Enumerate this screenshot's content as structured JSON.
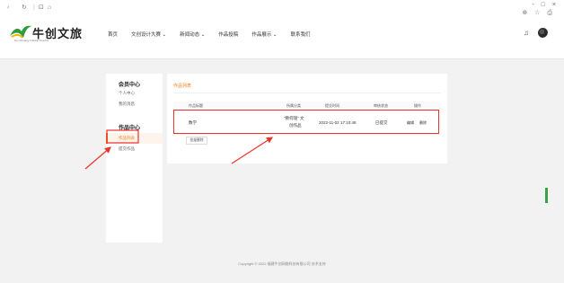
{
  "browser": {
    "back_icon": "‹",
    "refresh_icon": "↻",
    "tab_icon": "⊡",
    "home_icon": "⌂",
    "win_controls": "- □ ×",
    "toolbar_icons": "⊕ ☆ ⎙"
  },
  "site": {
    "logo_text": "牛创文旅",
    "logo_sub": "Niu Chuang Cultural Tourism",
    "nav": [
      "首页",
      "文创设计大赛 ⌄",
      "新闻动态 ⌄",
      "作品投稿",
      "作品展示 ⌄",
      "联系我们"
    ]
  },
  "sidebar": {
    "section1_title": "会员中心",
    "section1_items": [
      "个人中心",
      "我的消息"
    ],
    "section2_title": "作品中心",
    "active_item": "作品列表",
    "section2_items": [
      "提交作品"
    ]
  },
  "panel": {
    "title": "作品列表",
    "columns": [
      "作品标题",
      "所属分类",
      "提交时间",
      "审核状态",
      "操作"
    ],
    "rows": [
      {
        "title": "数学",
        "category_line1": "\"教何瑞\" 文",
        "category_line2": "创作品",
        "submitted": "2022-11-02 17:10:48",
        "status": "已提交",
        "op_edit": "编辑",
        "op_delete": "删除"
      }
    ],
    "bulk_delete": "批量删除"
  },
  "footer": {
    "text": "Copyright © 2022 福建牛创网络科技有限公司 技术支持"
  },
  "colors": {
    "accent": "#ff7a1a",
    "annotation_red": "#e8322d"
  }
}
